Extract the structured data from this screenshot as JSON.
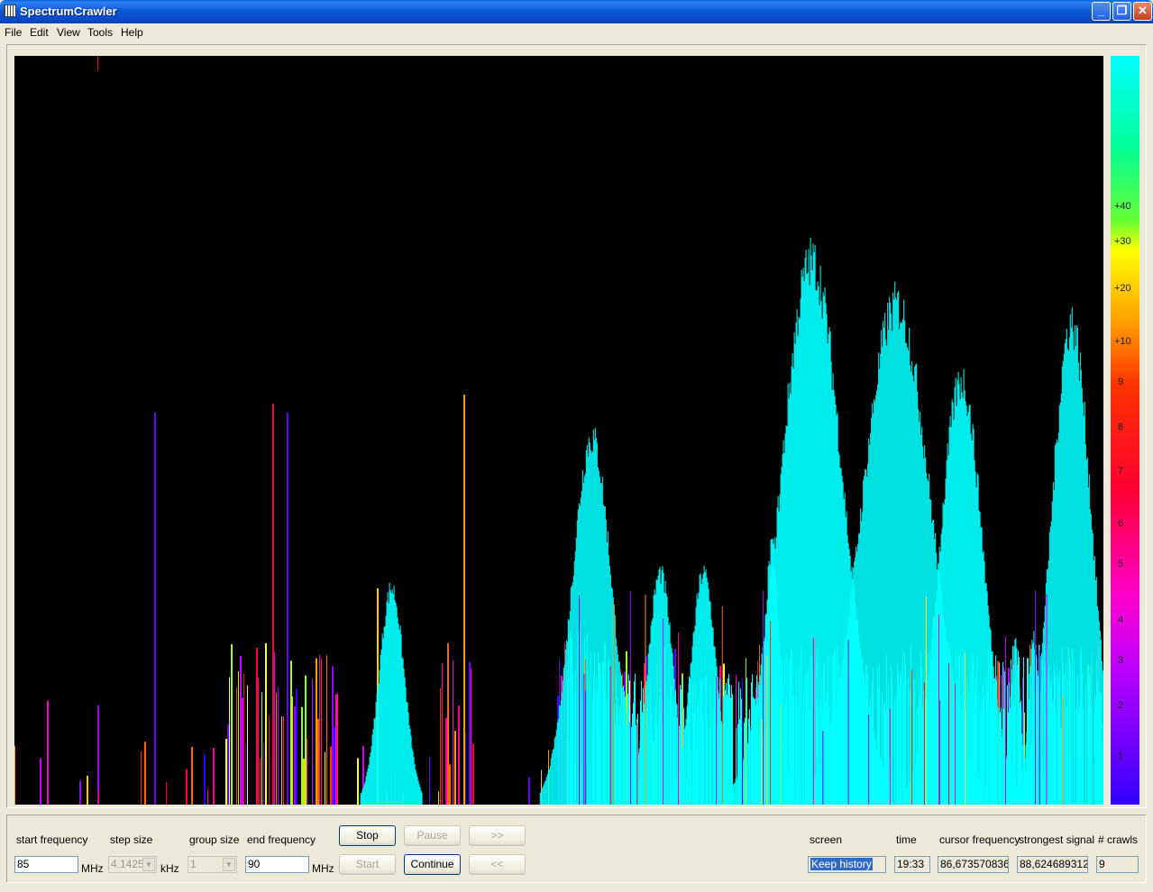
{
  "window": {
    "title": "SpectrumCrawler",
    "minimize": "_",
    "maximize": "❐",
    "close": "✕"
  },
  "menu": [
    "File",
    "Edit",
    "View",
    "Tools",
    "Help"
  ],
  "scale": [
    "+40",
    "+30",
    "+20",
    "+10",
    "9",
    "8",
    "7",
    "6",
    "5",
    "4",
    "3",
    "2",
    "1"
  ],
  "controls": {
    "start_frequency": {
      "label": "start frequency",
      "value": "85",
      "unit": "MHz"
    },
    "step_size": {
      "label": "step size",
      "value": "4.1425",
      "unit": "kHz"
    },
    "group_size": {
      "label": "group size",
      "value": "1"
    },
    "end_frequency": {
      "label": "end frequency",
      "value": "90",
      "unit": "MHz"
    },
    "buttons": {
      "stop": "Stop",
      "pause": "Pause",
      "forward": ">>",
      "start": "Start",
      "continue": "Continue",
      "back": "<<"
    }
  },
  "status": {
    "screen": {
      "label": "screen",
      "value": "Keep history"
    },
    "time": {
      "label": "time",
      "value": "19:33"
    },
    "cursor_frequency": {
      "label": "cursor frequency",
      "value": "86,673570836"
    },
    "strongest_signal": {
      "label": "strongest signal",
      "value": "88,624689312"
    },
    "crawls": {
      "label": "# crawls",
      "value": "9"
    }
  }
}
